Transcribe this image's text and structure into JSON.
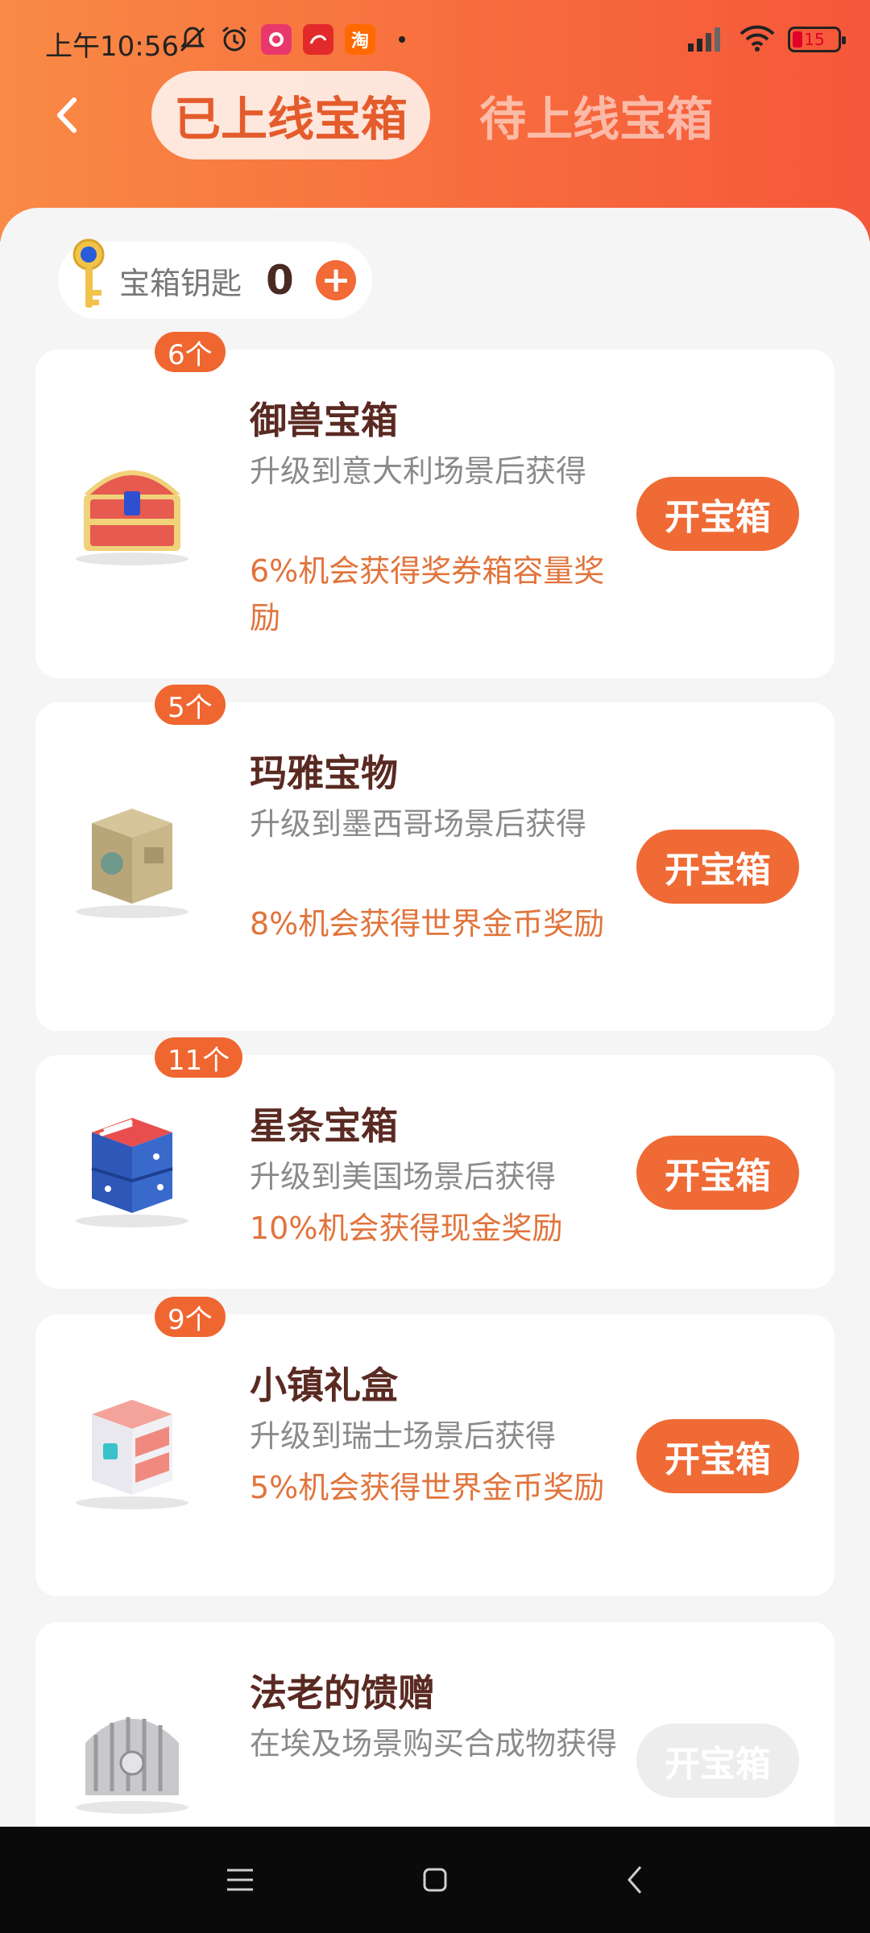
{
  "status": {
    "time": "上午10:56",
    "battery": "15",
    "app_icons": [
      "mute-bell-icon",
      "alarm-icon",
      "pink-app-icon",
      "red-app-icon",
      "taobao-icon"
    ],
    "taobao_label": "淘"
  },
  "header": {
    "tab_online": "已上线宝箱",
    "tab_upcoming": "待上线宝箱"
  },
  "keys": {
    "label": "宝箱钥匙",
    "count": "0",
    "add": "+"
  },
  "cards": [
    {
      "count": "6个",
      "title": "御兽宝箱",
      "desc": "升级到意大利场景后获得",
      "reward": "6%机会获得奖券箱容量奖励",
      "button": "开宝箱",
      "enabled": true
    },
    {
      "count": "5个",
      "title": "玛雅宝物",
      "desc": "升级到墨西哥场景后获得",
      "reward": "8%机会获得世界金币奖励",
      "button": "开宝箱",
      "enabled": true
    },
    {
      "count": "11个",
      "title": "星条宝箱",
      "desc": "升级到美国场景后获得",
      "reward": "10%机会获得现金奖励",
      "button": "开宝箱",
      "enabled": true
    },
    {
      "count": "9个",
      "title": "小镇礼盒",
      "desc": "升级到瑞士场景后获得",
      "reward": "5%机会获得世界金币奖励",
      "button": "开宝箱",
      "enabled": true
    },
    {
      "count": "",
      "title": "法老的馈赠",
      "desc": "在埃及场景购买合成物获得",
      "reward": "",
      "button": "开宝箱",
      "enabled": false
    }
  ],
  "colors": {
    "accent": "#ef6a35",
    "title": "#5a2a22",
    "reward": "#e1743c"
  }
}
